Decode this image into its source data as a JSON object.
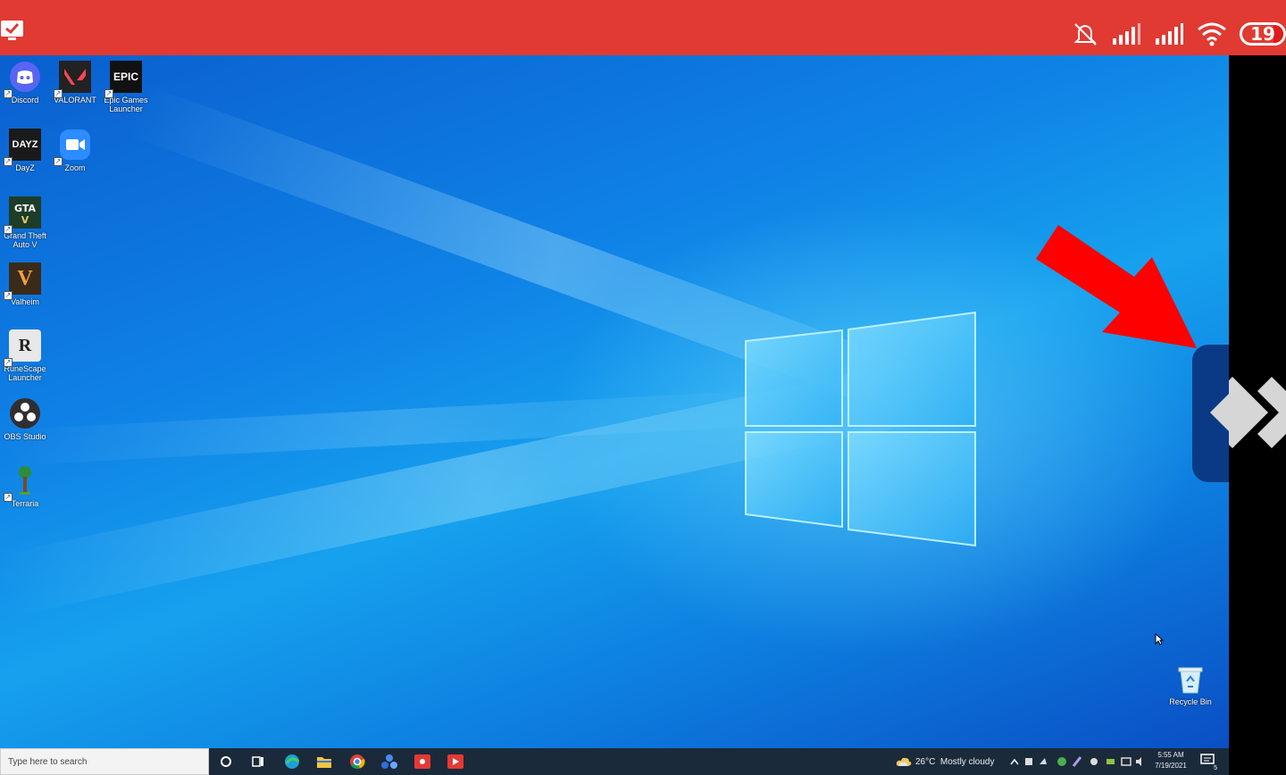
{
  "status_bar": {
    "app_icon": "red-check-icon",
    "icons": [
      "bell-muted-icon",
      "cell-signal-icon",
      "cell-signal-icon",
      "wifi-icon"
    ],
    "battery_level": "19",
    "battery_fill": 0.19,
    "background": "#e03a33"
  },
  "desktop": {
    "icons": [
      {
        "label": "Discord",
        "icon": "discord-icon"
      },
      {
        "label": "VALORANT",
        "icon": "valorant-icon"
      },
      {
        "label": "Epic Games Launcher",
        "icon": "epic-games-icon",
        "logo_text": "EPIC"
      },
      {
        "label": "DayZ",
        "icon": "dayz-icon",
        "logo_text": "DAYZ"
      },
      {
        "label": "Zoom",
        "icon": "zoom-icon"
      },
      {
        "label": "Grand Theft Auto V",
        "icon": "gta-icon"
      },
      {
        "label": "Valheim",
        "icon": "valheim-icon",
        "logo_text": "V"
      },
      {
        "label": "RuneScape Launcher",
        "icon": "runescape-icon",
        "logo_text": "R"
      },
      {
        "label": "OBS Studio",
        "icon": "obs-icon"
      },
      {
        "label": "Terraria",
        "icon": "terraria-icon"
      }
    ],
    "recycle_bin": {
      "label": "Recycle Bin",
      "icon": "recycle-bin-icon"
    }
  },
  "annotation": {
    "arrow": "red-arrow-icon",
    "color": "#ff0000"
  },
  "side_panel": {
    "icon": "diamond-icon"
  },
  "taskbar": {
    "search_placeholder": "Type here to search",
    "pinned": [
      "cortana-icon",
      "task-view-icon",
      "edge-icon",
      "file-explorer-icon",
      "chrome-icon",
      "app-icon",
      "recorder-icon",
      "recorder-icon"
    ],
    "weather": "26°C  Mostly cloudy",
    "time": "5:55 AM",
    "date": "7/19/2021",
    "notification_count": "5"
  }
}
